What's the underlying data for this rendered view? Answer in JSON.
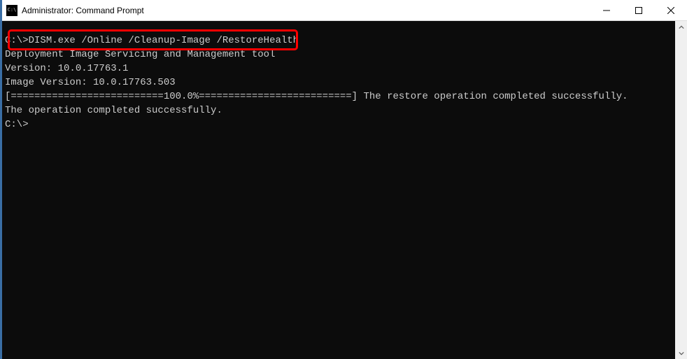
{
  "titlebar": {
    "title": "Administrator: Command Prompt"
  },
  "terminal": {
    "line1_prompt": "C:\\>",
    "line1_command": "DISM.exe /Online /Cleanup-Image /RestoreHealth",
    "line2": "",
    "line3": "Deployment Image Servicing and Management tool",
    "line4": "Version: 10.0.17763.1",
    "line5": "",
    "line6": "Image Version: 10.0.17763.503",
    "line7": "",
    "line8": "[==========================100.0%==========================] The restore operation completed successfully.",
    "line9": "The operation completed successfully.",
    "line10": "",
    "line11": "C:\\>"
  }
}
